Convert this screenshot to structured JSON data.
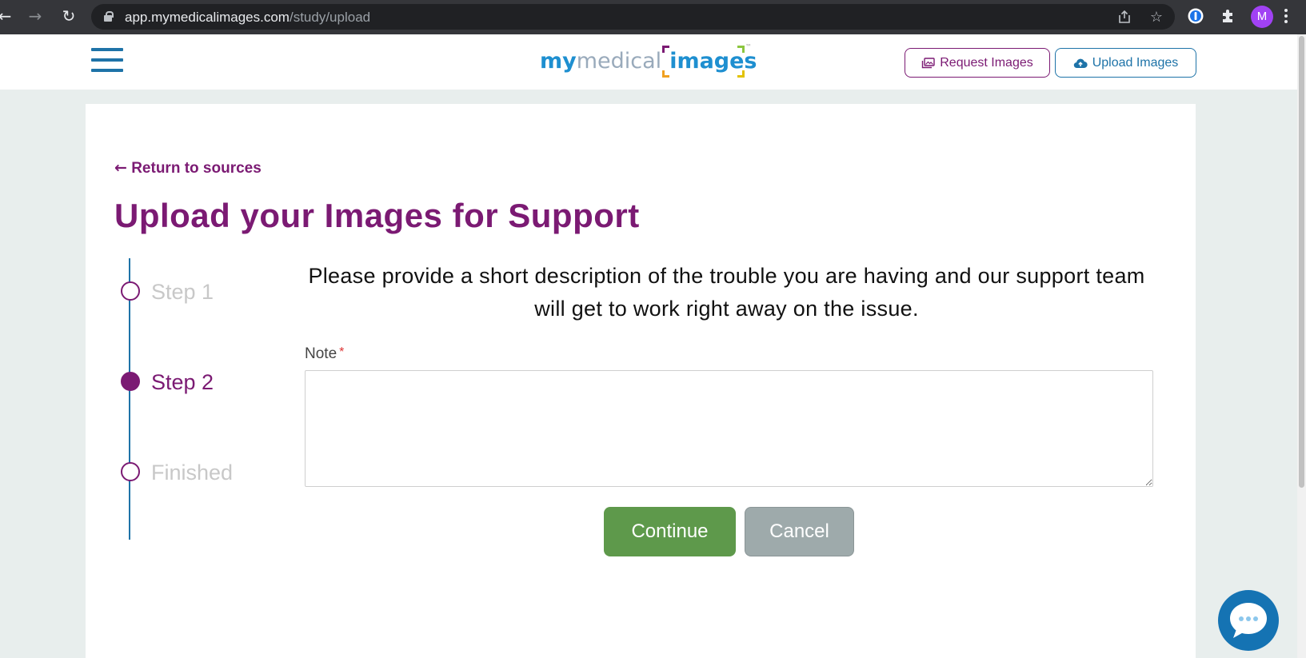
{
  "browser": {
    "url_host": "app.mymedicalimages.com",
    "url_path": "/study/upload",
    "profile_initial": "M",
    "icons": [
      "back-arrow-icon",
      "forward-arrow-icon",
      "reload-icon",
      "lock-icon",
      "share-icon",
      "star-icon",
      "password-manager-icon",
      "extensions-puzzle-icon",
      "kebab-menu-icon"
    ]
  },
  "header": {
    "logo": {
      "my": "my",
      "medical": "medical",
      "images": "images",
      "tm": "™"
    },
    "request_label": "Request Images",
    "upload_label": "Upload Images",
    "colors": {
      "brand_purple": "#7b1a73",
      "brand_blue": "#1e73a8"
    }
  },
  "main": {
    "back_link": "Return to sources",
    "title": "Upload your Images for Support",
    "steps": [
      {
        "label": "Step 1",
        "state": "inactive"
      },
      {
        "label": "Step 2",
        "state": "active"
      },
      {
        "label": "Finished",
        "state": "inactive"
      }
    ],
    "description": "Please provide a short description of the trouble you are having and our support team will get to work right away on the issue.",
    "note_label": "Note",
    "note_required_mark": "*",
    "note_value": "",
    "continue_label": "Continue",
    "cancel_label": "Cancel",
    "colors": {
      "continue": "#5e994b",
      "cancel": "#9eaaab"
    }
  },
  "chat_widget": {
    "icon": "chat-bubble-icon",
    "color": "#1573b3"
  }
}
